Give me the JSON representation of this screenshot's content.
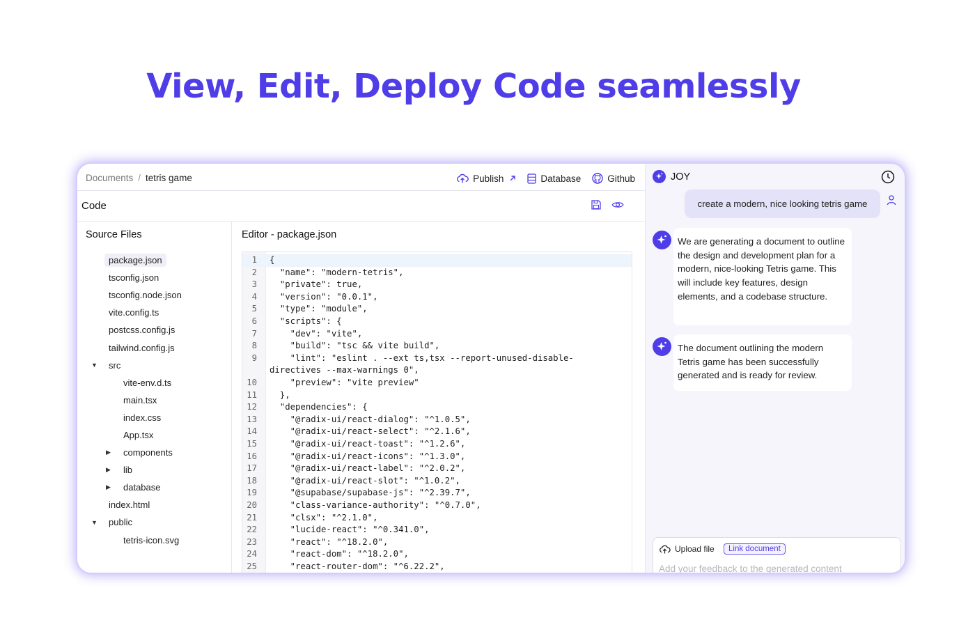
{
  "hero": {
    "title": "View, Edit, Deploy Code seamlessly"
  },
  "breadcrumb": {
    "root": "Documents",
    "separator": "/",
    "current": "tetris game"
  },
  "toolbar": {
    "publish_label": "Publish",
    "database_label": "Database",
    "github_label": "Github",
    "publish_icon": "cloud-upload-icon",
    "database_icon": "database-icon",
    "github_icon": "github-icon"
  },
  "code_section": {
    "label": "Code",
    "icons": [
      "save-icon",
      "eye-icon"
    ]
  },
  "source_files": {
    "title": "Source Files",
    "items": [
      {
        "name": "package.json",
        "level": 1,
        "type": "file",
        "selected": true
      },
      {
        "name": "tsconfig.json",
        "level": 1,
        "type": "file"
      },
      {
        "name": "tsconfig.node.json",
        "level": 1,
        "type": "file"
      },
      {
        "name": "vite.config.ts",
        "level": 1,
        "type": "file"
      },
      {
        "name": "postcss.config.js",
        "level": 1,
        "type": "file"
      },
      {
        "name": "tailwind.config.js",
        "level": 1,
        "type": "file"
      },
      {
        "name": "src",
        "level": 1,
        "type": "folder",
        "expanded": true
      },
      {
        "name": "vite-env.d.ts",
        "level": 2,
        "type": "file"
      },
      {
        "name": "main.tsx",
        "level": 2,
        "type": "file"
      },
      {
        "name": "index.css",
        "level": 2,
        "type": "file"
      },
      {
        "name": "App.tsx",
        "level": 2,
        "type": "file"
      },
      {
        "name": "components",
        "level": 2,
        "type": "folder",
        "expanded": false
      },
      {
        "name": "lib",
        "level": 2,
        "type": "folder",
        "expanded": false
      },
      {
        "name": "database",
        "level": 2,
        "type": "folder",
        "expanded": false
      },
      {
        "name": "index.html",
        "level": 1,
        "type": "file"
      },
      {
        "name": "public",
        "level": 1,
        "type": "folder",
        "expanded": true
      },
      {
        "name": "tetris-icon.svg",
        "level": 2,
        "type": "file"
      }
    ]
  },
  "editor": {
    "title": "Editor - package.json",
    "lines": [
      {
        "num": "1",
        "text": "{"
      },
      {
        "num": "2",
        "text": "  \"name\": \"modern-tetris\","
      },
      {
        "num": "3",
        "text": "  \"private\": true,"
      },
      {
        "num": "4",
        "text": "  \"version\": \"0.0.1\","
      },
      {
        "num": "5",
        "text": "  \"type\": \"module\","
      },
      {
        "num": "6",
        "text": "  \"scripts\": {"
      },
      {
        "num": "7",
        "text": "    \"dev\": \"vite\","
      },
      {
        "num": "8",
        "text": "    \"build\": \"tsc && vite build\","
      },
      {
        "num": "9",
        "text": "    \"lint\": \"eslint . --ext ts,tsx --report-unused-disable-"
      },
      {
        "num": "",
        "text": "directives --max-warnings 0\","
      },
      {
        "num": "10",
        "text": "    \"preview\": \"vite preview\""
      },
      {
        "num": "11",
        "text": "  },"
      },
      {
        "num": "12",
        "text": "  \"dependencies\": {"
      },
      {
        "num": "13",
        "text": "    \"@radix-ui/react-dialog\": \"^1.0.5\","
      },
      {
        "num": "14",
        "text": "    \"@radix-ui/react-select\": \"^2.1.6\","
      },
      {
        "num": "15",
        "text": "    \"@radix-ui/react-toast\": \"^1.2.6\","
      },
      {
        "num": "16",
        "text": "    \"@radix-ui/react-icons\": \"^1.3.0\","
      },
      {
        "num": "17",
        "text": "    \"@radix-ui/react-label\": \"^2.0.2\","
      },
      {
        "num": "18",
        "text": "    \"@radix-ui/react-slot\": \"^1.0.2\","
      },
      {
        "num": "19",
        "text": "    \"@supabase/supabase-js\": \"^2.39.7\","
      },
      {
        "num": "20",
        "text": "    \"class-variance-authority\": \"^0.7.0\","
      },
      {
        "num": "21",
        "text": "    \"clsx\": \"^2.1.0\","
      },
      {
        "num": "22",
        "text": "    \"lucide-react\": \"^0.341.0\","
      },
      {
        "num": "23",
        "text": "    \"react\": \"^18.2.0\","
      },
      {
        "num": "24",
        "text": "    \"react-dom\": \"^18.2.0\","
      },
      {
        "num": "25",
        "text": "    \"react-router-dom\": \"^6.22.2\","
      }
    ]
  },
  "chat": {
    "assistant_name": "JOY",
    "history_icon": "clock-icon",
    "user_message": "create a modern, nice looking tetris game",
    "bot_messages": [
      "We are generating a document to outline the design and development plan for a modern, nice-looking Tetris game. This will include key features, design elements, and a codebase structure.",
      "The document outlining the modern Tetris game has been successfully generated and is ready for review."
    ],
    "upload_label": "Upload file",
    "link_document_label": "Link document",
    "feedback_placeholder": "Add your feedback to the generated content"
  },
  "colors": {
    "accent": "#4f3ee8",
    "user_bubble": "#e3e2f8",
    "panel_bg": "#f5f5fb"
  }
}
